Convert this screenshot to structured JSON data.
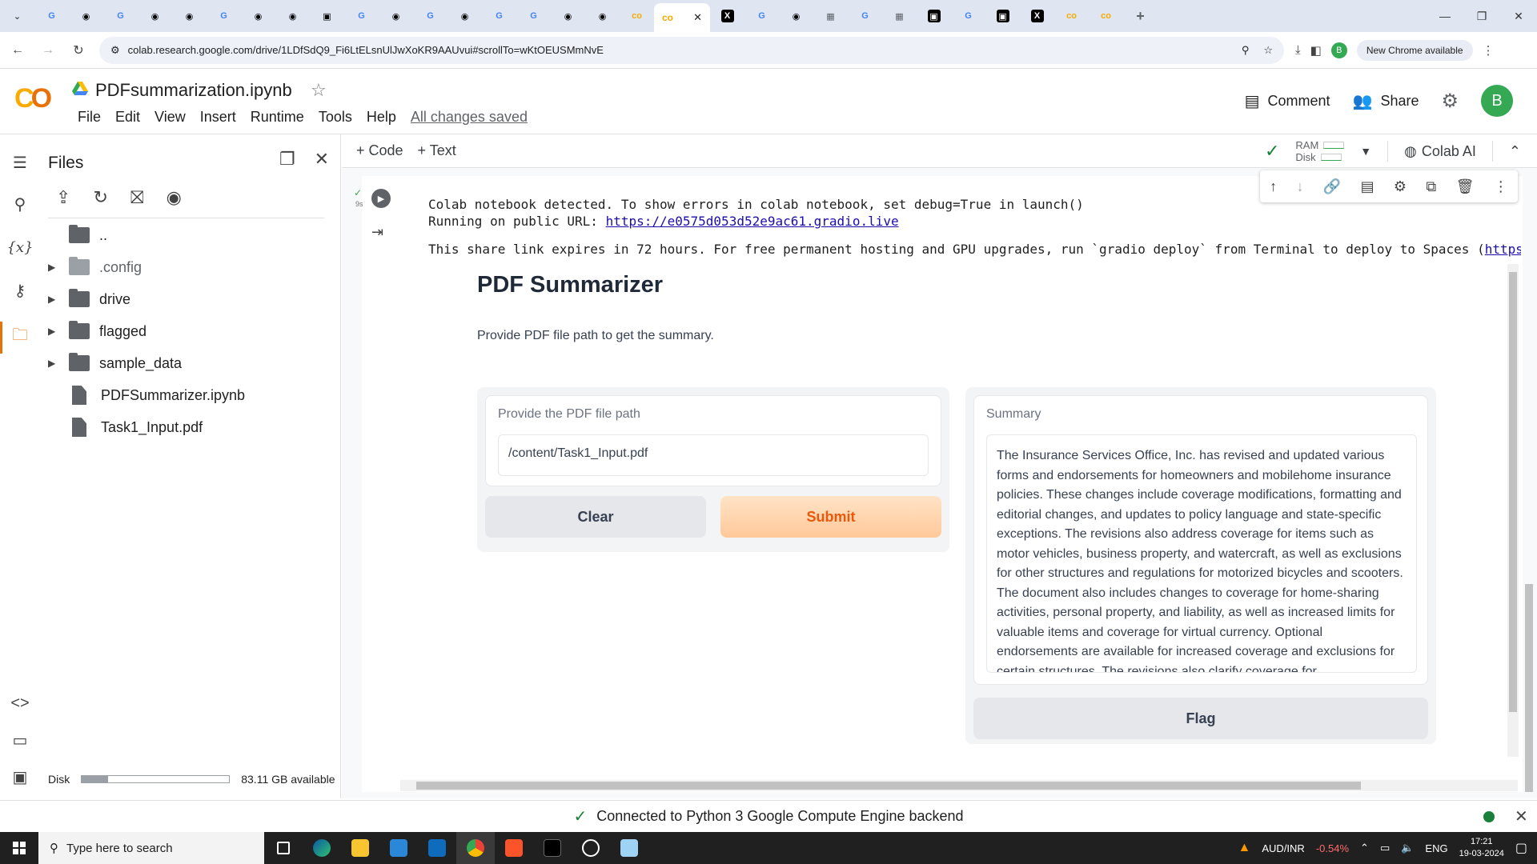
{
  "browser": {
    "url": "colab.research.google.com/drive/1LDfSdQ9_Fi6LtELsnUlJwXoKR9AAUvui#scrollTo=wKtOEUSMmNvE",
    "update_notice": "New Chrome available",
    "profile_initial": "B",
    "tabs": [
      "google-icon",
      "github-icon",
      "google-icon",
      "github-icon",
      "github-icon",
      "google-icon",
      "github-icon",
      "github-icon",
      "terminal-icon",
      "google-icon",
      "github-icon",
      "google-icon",
      "github-icon",
      "google-icon",
      "google-icon",
      "github-icon",
      "github-icon",
      "colab-icon"
    ]
  },
  "colab": {
    "notebook_title": "PDFsummarization.ipynb",
    "menu": [
      "File",
      "Edit",
      "View",
      "Insert",
      "Runtime",
      "Tools",
      "Help"
    ],
    "save_status": "All changes saved",
    "comment_label": "Comment",
    "share_label": "Share",
    "avatar_initial": "B",
    "toolbar": {
      "add_code": "+ Code",
      "add_text": "+ Text",
      "ram_label": "RAM",
      "disk_label": "Disk",
      "colab_ai": "Colab AI"
    }
  },
  "files_panel": {
    "title": "Files",
    "items": [
      {
        "name": "..",
        "type": "parent"
      },
      {
        "name": ".config",
        "type": "folder"
      },
      {
        "name": "drive",
        "type": "folder"
      },
      {
        "name": "flagged",
        "type": "folder"
      },
      {
        "name": "sample_data",
        "type": "folder"
      },
      {
        "name": "PDFSummarizer.ipynb",
        "type": "file"
      },
      {
        "name": "Task1_Input.pdf",
        "type": "file"
      }
    ],
    "disk_label": "Disk",
    "disk_available": "83.11 GB available",
    "disk_used_fraction": 0.18
  },
  "cell": {
    "exec_time": "9s",
    "output_line1": "Colab notebook detected. To show errors in colab notebook, set debug=True in launch()",
    "output_line2_prefix": "Running on public URL: ",
    "public_url": "https://e0575d053d52e9ac61.gradio.live",
    "output_line3_prefix": "This share link expires in 72 hours. For free permanent hosting and GPU upgrades, run `gradio deploy` from Terminal to deploy to Spaces (",
    "output_line3_link": "https://"
  },
  "gradio": {
    "title": "PDF Summarizer",
    "description": "Provide PDF file path to get the summary.",
    "input_label": "Provide the PDF file path",
    "input_value": "/content/Task1_Input.pdf",
    "clear_label": "Clear",
    "submit_label": "Submit",
    "summary_label": "Summary",
    "summary_text": " The Insurance Services Office, Inc. has revised and updated various forms and endorsements for homeowners and mobilehome insurance policies. These changes include coverage modifications, formatting and editorial changes, and updates to policy language and state-specific exceptions. The revisions also address coverage for items such as motor vehicles, business property, and watercraft, as well as exclusions for other structures and regulations for motorized bicycles and scooters. The document also includes changes to coverage for home-sharing activities, personal property, and liability, as well as increased limits for valuable items and coverage for virtual currency. Optional endorsements are available for increased coverage and exclusions for certain structures. The revisions also clarify coverage for",
    "flag_label": "Flag"
  },
  "status": {
    "connection": "Connected to Python 3 Google Compute Engine backend"
  },
  "taskbar": {
    "search_placeholder": "Type here to search",
    "ticker_pair": "AUD/INR",
    "ticker_change": "-0.54%",
    "lang": "ENG",
    "time": "17:21",
    "date": "19-03-2024"
  },
  "colors": {
    "accent_orange": "#e8710a",
    "submit_text": "#ea580c",
    "connected_green": "#188038"
  }
}
